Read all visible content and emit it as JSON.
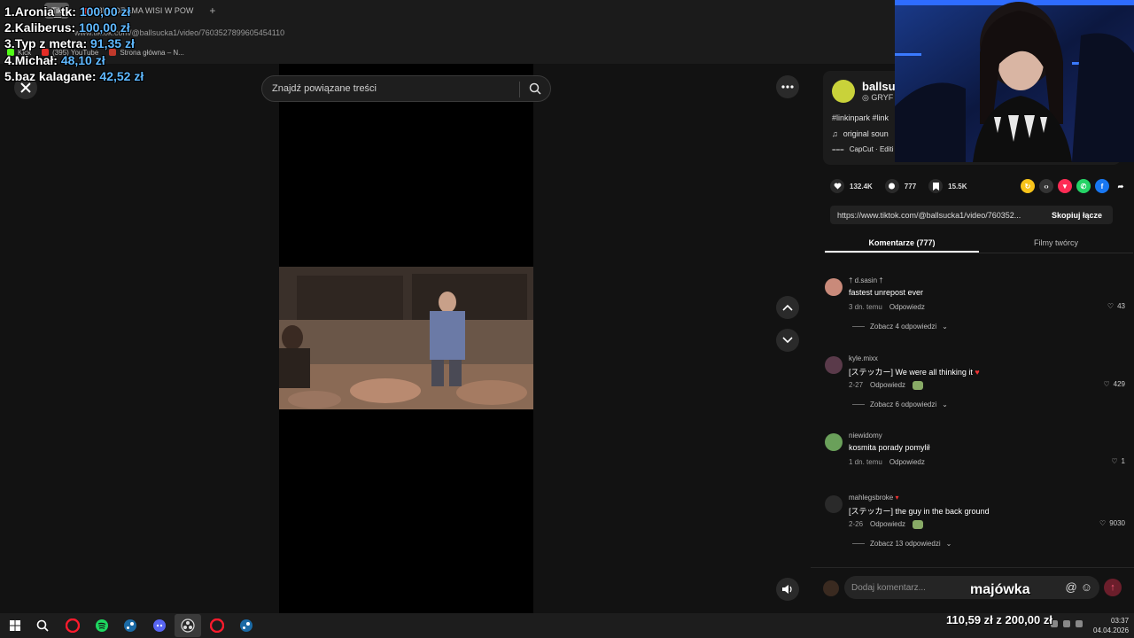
{
  "browser": {
    "tabs": [
      {
        "label": "(85) \"DRAMA WISI W POW"
      }
    ],
    "active_tab_label": "Tik",
    "url": "www.tiktok.com/@ballsucka1/video/7603527899605454110",
    "bookmarks": [
      "Kick",
      "(395) YouTube",
      "Strona główna – N..."
    ]
  },
  "donations": [
    {
      "rank": "1.",
      "name": "Aronia_tk:",
      "amount": "100,00 zł"
    },
    {
      "rank": "2.",
      "name": "Kaliberus:",
      "amount": "100,00 zł"
    },
    {
      "rank": "3.",
      "name": "Typ z metra:",
      "amount": "91,35 zł"
    },
    {
      "rank": "4.",
      "name": "Michał:",
      "amount": "48,10 zł"
    },
    {
      "rank": "5.",
      "name": "baz kalagane:",
      "amount": "42,52 zł"
    }
  ],
  "video": {
    "search_placeholder": "Znajdź powiązane treści"
  },
  "author": {
    "name": "ballsu",
    "sub": "◎ GRYF",
    "hashtags": "#linkinpark #link",
    "music": "original soun",
    "capcut": "CapCut · Editi"
  },
  "stats": {
    "likes": "132.4K",
    "comments": "777",
    "saves": "15.5K"
  },
  "link": {
    "url": "https://www.tiktok.com/@ballsucka1/video/760352...",
    "copy_label": "Skopiuj łącze"
  },
  "panel_tabs": [
    {
      "label": "Komentarze (777)",
      "active": true
    },
    {
      "label": "Filmy twórcy",
      "active": false
    }
  ],
  "comments": [
    {
      "user": "† d.sasin †",
      "text": "fastest unrepost ever",
      "date": "3 dn. temu",
      "reply": "Odpowiedz",
      "likes": "43",
      "more": "Zobacz 4 odpowiedzi",
      "avatar_color": "#c98a7a"
    },
    {
      "user": "kyle.mixx",
      "text": "[ステッカー] We were all thinking it",
      "date": "2-27",
      "reply": "Odpowiedz",
      "likes": "429",
      "more": "Zobacz 6 odpowiedzi",
      "avatar_color": "#5a3a4a"
    },
    {
      "user": "niewidomy",
      "text": "kosmita porady pomylił",
      "date": "1 dn. temu",
      "reply": "Odpowiedz",
      "likes": "1",
      "more": "",
      "avatar_color": "#6aa05a"
    },
    {
      "user": "mahlegsbroke",
      "text": "[ステッカー] the guy in the back ground",
      "date": "2-26",
      "reply": "Odpowiedz",
      "likes": "9030",
      "more": "Zobacz 13 odpowiedzi",
      "avatar_color": "#2a2a2a"
    }
  ],
  "comment_input": {
    "placeholder": "Dodaj komentarz...",
    "overlay_word": "majówka"
  },
  "goal": "110,59 zł z 200,00 zł",
  "clock": {
    "time": "03:37",
    "date": "04.04.2026"
  },
  "colors": {
    "accent_blue": "#5fb8ff",
    "tiktok_red": "#fe2c55"
  }
}
